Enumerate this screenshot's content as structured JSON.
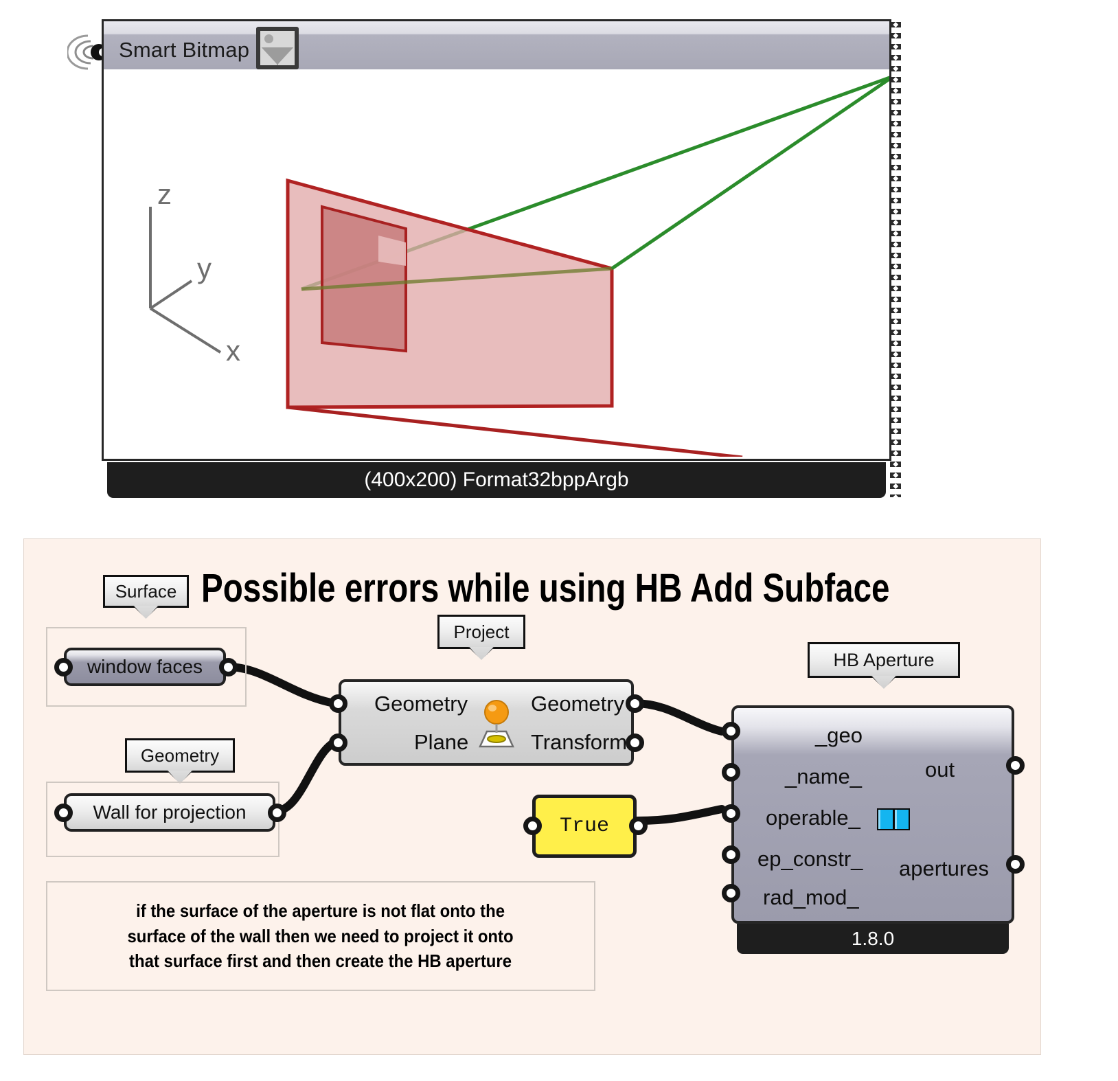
{
  "bitmap_viewer": {
    "title": "Smart Bitmap",
    "icon": "image-icon",
    "footer": "(400x200) Format32bppArgb",
    "viewport": {
      "axis_labels": [
        "z",
        "y",
        "x"
      ],
      "geometry_description": "red translucent wall plane with a smaller red aperture face and a green projection line",
      "colors": {
        "wall_fill": "#e0a8a8",
        "wall_edge": "#b02727",
        "aperture_fill": "#cf8181",
        "line_green": "#2a8a2a",
        "axis": "#6b6b6b"
      }
    }
  },
  "gh_group": {
    "background": "#fdf2eb",
    "title": "Possible errors while using HB Add Subface",
    "tags": {
      "surface": "Surface",
      "geometry": "Geometry",
      "project": "Project",
      "hb_aperture": "HB Aperture"
    },
    "params": [
      {
        "name": "window faces",
        "style": "dark"
      },
      {
        "name": "Wall for projection",
        "style": "light"
      }
    ],
    "project_component": {
      "inputs": [
        "Geometry",
        "Plane"
      ],
      "outputs": [
        "Geometry",
        "Transform"
      ],
      "icon": "project-icon"
    },
    "boolean_panel": {
      "value": "True"
    },
    "hb_aperture_component": {
      "inputs": [
        "_geo",
        "_name_",
        "operable_",
        "ep_constr_",
        "rad_mod_"
      ],
      "outputs": [
        "out",
        "apertures"
      ],
      "icon": "operable-window-icon",
      "version": "1.8.0"
    },
    "note": {
      "line1": "if the surface of the aperture is not flat onto the",
      "line2": "surface of the wall then we need to project it onto",
      "line3": "that surface first and then create the HB aperture"
    }
  }
}
